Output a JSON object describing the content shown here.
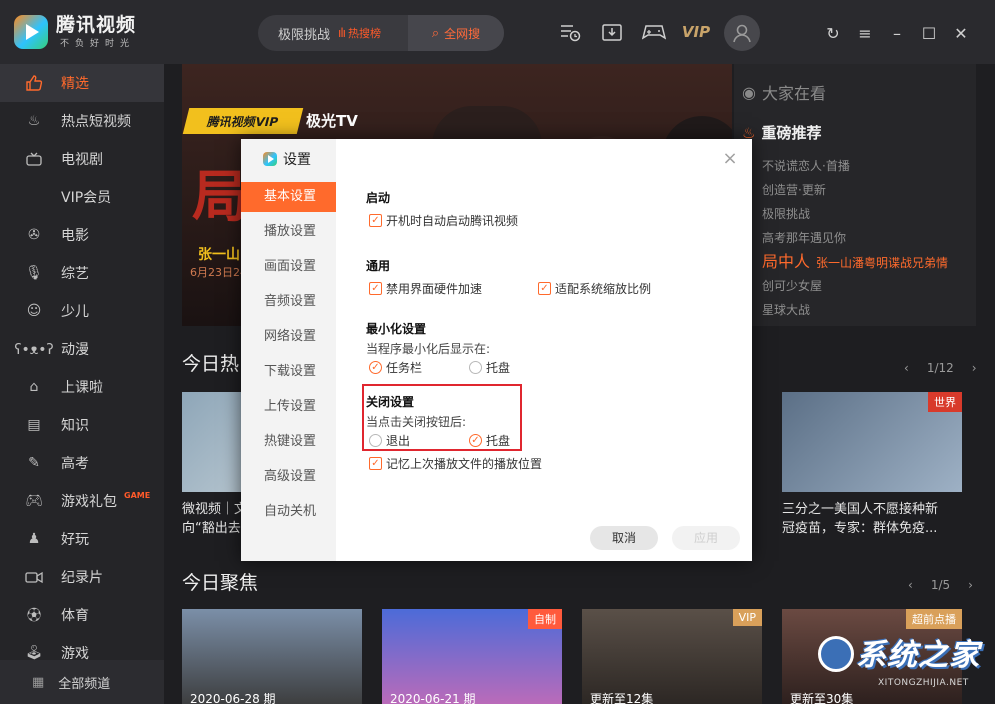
{
  "app": {
    "title": "腾讯视频",
    "slogan": "不负好时光"
  },
  "search": {
    "current_text": "极限挑战",
    "hot_label": "热搜榜",
    "search_all_label": "全网搜"
  },
  "topbar": {
    "vip_label": "VIP",
    "icons": [
      "play-history-icon",
      "download-icon",
      "gamepad-icon",
      "vip-icon",
      "avatar-icon",
      "refresh-icon",
      "menu-icon",
      "minimize-icon",
      "maximize-icon",
      "close-icon"
    ]
  },
  "sidebar": {
    "items": [
      {
        "label": "精选",
        "icon": "thumb-up-icon"
      },
      {
        "label": "热点短视频",
        "icon": "flame-icon"
      },
      {
        "label": "电视剧",
        "icon": "tv-icon"
      },
      {
        "label": "VIP会员",
        "icon": ""
      },
      {
        "label": "电影",
        "icon": "film-reel-icon"
      },
      {
        "label": "综艺",
        "icon": "microphone-icon"
      },
      {
        "label": "少儿",
        "icon": "kids-icon"
      },
      {
        "label": "动漫",
        "icon": "bear-icon"
      },
      {
        "label": "上课啦",
        "icon": "graduation-cap-icon"
      },
      {
        "label": "知识",
        "icon": "book-icon"
      },
      {
        "label": "高考",
        "icon": "pencil-icon"
      },
      {
        "label": "游戏礼包",
        "icon": "gamepad-icon",
        "badge": "GAME"
      },
      {
        "label": "好玩",
        "icon": "figure-icon"
      },
      {
        "label": "纪录片",
        "icon": "camera-icon"
      },
      {
        "label": "体育",
        "icon": "ball-icon"
      },
      {
        "label": "游戏",
        "icon": "joystick-icon"
      }
    ],
    "all_channels": "全部频道"
  },
  "banner": {
    "brand1": "腾讯视频VIP",
    "brand2": "极光TV",
    "big_char": "局",
    "actor": "张一山",
    "date": "6月23日24..."
  },
  "side_panel": {
    "title": "大家在看",
    "subtitle": "重磅推荐",
    "items": [
      {
        "label": "不说谎恋人·首播"
      },
      {
        "label": "创造营·更新"
      },
      {
        "label": "极限挑战"
      },
      {
        "label": "高考那年遇见你"
      },
      {
        "label": "局中人",
        "sub": "张一山潘粤明谍战兄弟情",
        "highlight": true
      },
      {
        "label": "创可少女屋"
      },
      {
        "label": "星球大战"
      }
    ]
  },
  "section_hot": {
    "title": "今日热",
    "pager": "1/12",
    "cards": [
      {
        "caption": "微视频｜文\n向“豁出去"
      },
      {
        "caption": "三分之一美国人不愿接种新\n冠疫苗，专家：群体免疫..."
      }
    ]
  },
  "section_focus": {
    "title": "今日聚焦",
    "pager": "1/5",
    "cards": [
      {
        "overlay": "2020-06-28 期",
        "badge": ""
      },
      {
        "overlay": "2020-06-21 期",
        "badge": "自制"
      },
      {
        "overlay": "更新至12集",
        "badge": "VIP"
      },
      {
        "overlay": "更新至30集",
        "badge": "超前点播"
      }
    ]
  },
  "settings_dialog": {
    "title": "设置",
    "nav": [
      "基本设置",
      "播放设置",
      "画面设置",
      "音频设置",
      "网络设置",
      "下载设置",
      "上传设置",
      "热键设置",
      "高级设置",
      "自动关机"
    ],
    "active_nav": "基本设置",
    "startup": {
      "heading": "启动",
      "autostart_label": "开机时自动启动腾讯视频",
      "autostart_checked": true
    },
    "general": {
      "heading": "通用",
      "hw_accel_label": "禁用界面硬件加速",
      "hw_accel_checked": true,
      "scale_label": "适配系统缩放比例",
      "scale_checked": true
    },
    "minimize": {
      "heading": "最小化设置",
      "desc": "当程序最小化后显示在:",
      "options": [
        "任务栏",
        "托盘"
      ],
      "selected": "任务栏"
    },
    "close": {
      "heading": "关闭设置",
      "desc": "当点击关闭按钮后:",
      "options": [
        "退出",
        "托盘"
      ],
      "selected": "托盘"
    },
    "remember_label": "记忆上次播放文件的播放位置",
    "remember_checked": true,
    "cancel_label": "取消",
    "apply_label": "应用"
  },
  "watermark": {
    "main": "系统之家",
    "sub": "XITONGZHIJIA.NET"
  },
  "colors": {
    "accent": "#ff6a2c",
    "highlight_box": "#e0262f",
    "background": "#1e1e21"
  }
}
